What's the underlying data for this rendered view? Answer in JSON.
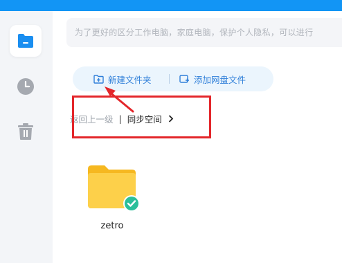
{
  "notice": {
    "text": "为了更好的区分工作电脑，家庭电脑，保护个人隐私，可以进行"
  },
  "sidebar": {
    "items": [
      {
        "name": "folder-icon",
        "active": true
      },
      {
        "name": "clock-icon",
        "active": false
      },
      {
        "name": "trash-icon",
        "active": false
      }
    ]
  },
  "actions": {
    "new_folder_label": "新建文件夹",
    "add_cloud_label": "添加网盘文件"
  },
  "breadcrumb": {
    "back_label": "返回上一级",
    "separator": "|",
    "current": "同步空间"
  },
  "folders": [
    {
      "name": "zetro",
      "status": "synced"
    }
  ],
  "colors": {
    "brand": "#1295f5",
    "action_text": "#2f7fd9",
    "annotation": "#e3262a",
    "folder": "#fdc93a",
    "synced": "#2bbf9a"
  }
}
